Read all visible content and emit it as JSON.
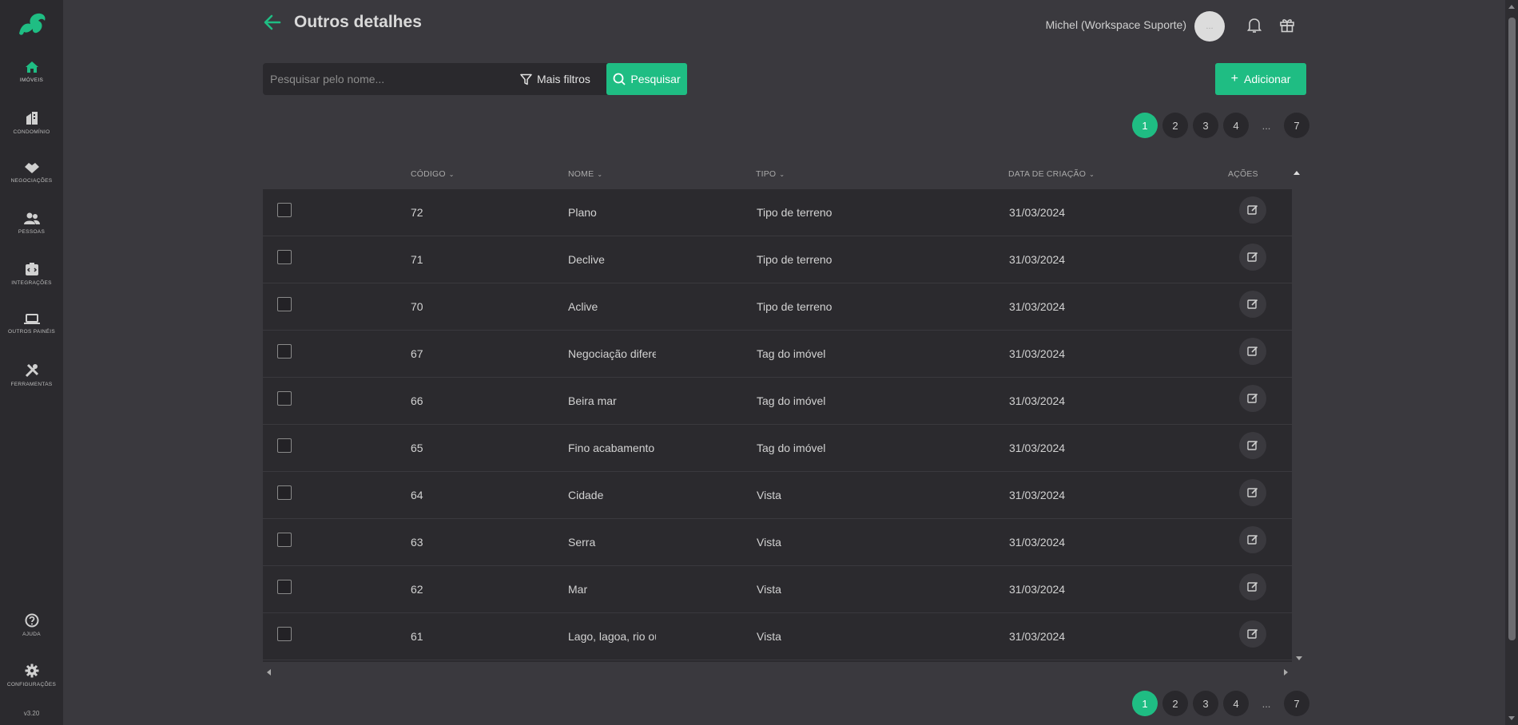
{
  "app": {
    "version": "v3.20"
  },
  "sidebar": {
    "items": [
      {
        "label": "Imóveis",
        "icon": "home-icon"
      },
      {
        "label": "Condomínio",
        "icon": "building-icon"
      },
      {
        "label": "Negociações",
        "icon": "handshake-icon"
      },
      {
        "label": "Pessoas",
        "icon": "people-icon"
      },
      {
        "label": "Integrações",
        "icon": "integration-icon"
      },
      {
        "label": "Outros painéis",
        "icon": "laptop-icon"
      },
      {
        "label": "Ferramentas",
        "icon": "tools-icon"
      }
    ],
    "bottom": [
      {
        "label": "Ajuda",
        "icon": "help-icon"
      },
      {
        "label": "Configurações",
        "icon": "gear-icon"
      }
    ]
  },
  "header": {
    "title": "Outros detalhes",
    "user_name": "Michel (Workspace Suporte)",
    "avatar_text": "..."
  },
  "search": {
    "placeholder": "Pesquisar pelo nome...",
    "more_filters_label": "Mais filtros",
    "search_button_label": "Pesquisar"
  },
  "add_button_label": "Adicionar",
  "pagination": {
    "pages": [
      "1",
      "2",
      "3",
      "4"
    ],
    "ellipsis": "...",
    "last": "7",
    "current": "1"
  },
  "table": {
    "columns": {
      "code": "CÓDIGO",
      "name": "NOME",
      "type": "TIPO",
      "created": "DATA DE CRIAÇÃO",
      "actions": "AÇÕES"
    },
    "rows": [
      {
        "code": "72",
        "name": "Plano",
        "type": "Tipo de terreno",
        "created": "31/03/2024"
      },
      {
        "code": "71",
        "name": "Declive",
        "type": "Tipo de terreno",
        "created": "31/03/2024"
      },
      {
        "code": "70",
        "name": "Aclive",
        "type": "Tipo de terreno",
        "created": "31/03/2024"
      },
      {
        "code": "67",
        "name": "Negociação difere",
        "type": "Tag do imóvel",
        "created": "31/03/2024"
      },
      {
        "code": "66",
        "name": "Beira mar",
        "type": "Tag do imóvel",
        "created": "31/03/2024"
      },
      {
        "code": "65",
        "name": "Fino acabamento",
        "type": "Tag do imóvel",
        "created": "31/03/2024"
      },
      {
        "code": "64",
        "name": "Cidade",
        "type": "Vista",
        "created": "31/03/2024"
      },
      {
        "code": "63",
        "name": "Serra",
        "type": "Vista",
        "created": "31/03/2024"
      },
      {
        "code": "62",
        "name": "Mar",
        "type": "Vista",
        "created": "31/03/2024"
      },
      {
        "code": "61",
        "name": "Lago, lagoa, rio ou",
        "type": "Vista",
        "created": "31/03/2024"
      }
    ]
  },
  "colors": {
    "accent": "#1fbd83",
    "background": "#3a393e",
    "sidebar": "#2b2a2e"
  }
}
